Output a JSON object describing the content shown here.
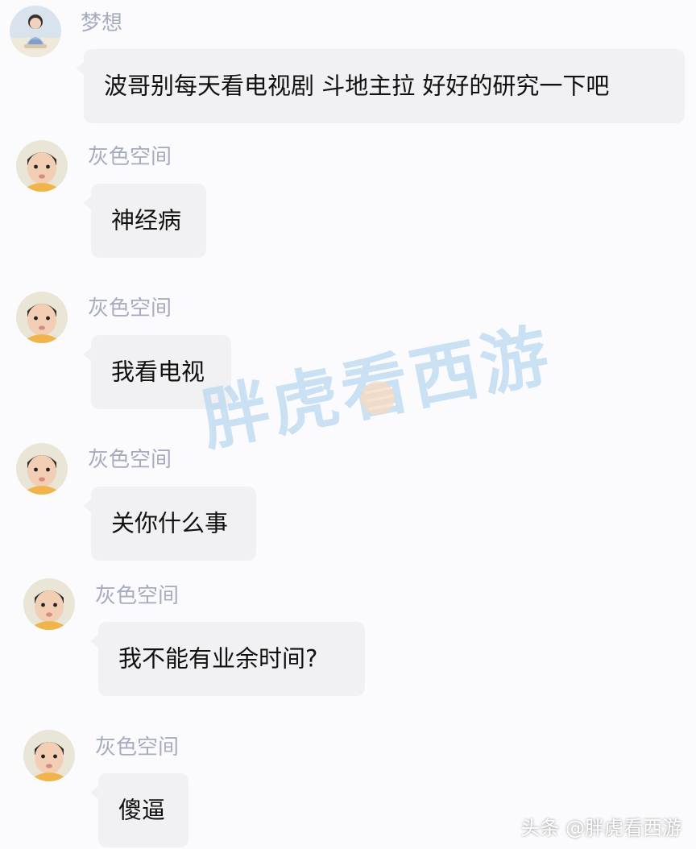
{
  "messages": [
    {
      "sender": "梦想",
      "text": "波哥别每天看电视剧 斗地主拉   好好的研究一下吧",
      "avatar": "woman-sitting-avatar"
    },
    {
      "sender": "灰色空间",
      "text": "神经病",
      "avatar": "baby-face-avatar"
    },
    {
      "sender": "灰色空间",
      "text": "我看电视",
      "avatar": "baby-face-avatar"
    },
    {
      "sender": "灰色空间",
      "text": "关你什么事",
      "avatar": "baby-face-avatar"
    },
    {
      "sender": "灰色空间",
      "text": "我不能有业余时间?",
      "avatar": "baby-face-avatar"
    },
    {
      "sender": "灰色空间",
      "text": "傻逼",
      "avatar": "baby-face-avatar"
    }
  ],
  "watermark": {
    "text": "胖虎看西游",
    "icon": "cat-face-icon"
  },
  "footer": {
    "text": "头条 @胖虎看西游"
  },
  "colors": {
    "background": "#fbfbfd",
    "bubble": "#f1f1f4",
    "sender_name": "#a6abc0",
    "message_text": "#111111",
    "watermark": "#b7d8ef"
  }
}
